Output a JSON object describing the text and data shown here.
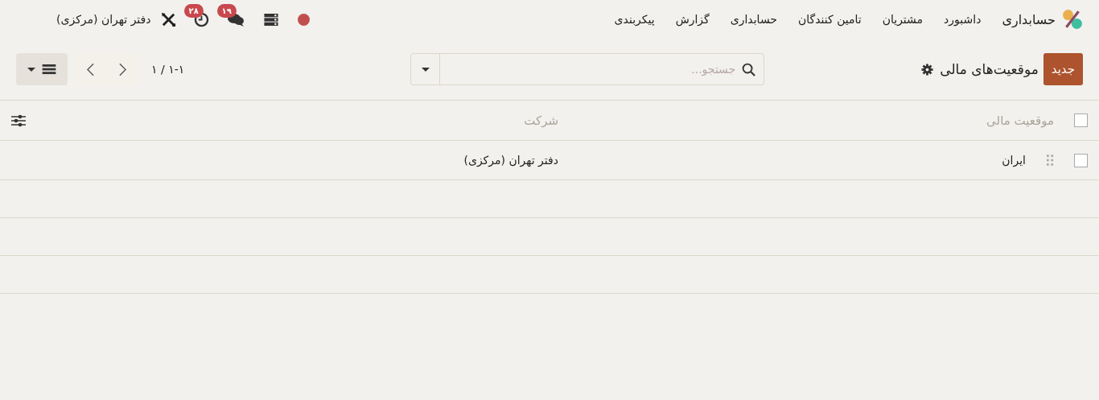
{
  "navbar": {
    "app_name": "حسابداری",
    "menu": [
      "داشبورد",
      "مشتریان",
      "تامین کنندگان",
      "حسابداری",
      "گزارش",
      "پیکربندی"
    ],
    "messages_count": "۱۹",
    "activities_count": "۲۸",
    "company": "دفتر تهران (مرکزی)"
  },
  "control_panel": {
    "new_button": "جدید",
    "title": "موقعیت‌های مالی",
    "search": {
      "placeholder": "جستجو..."
    },
    "pager": "۱-۱ / ۱"
  },
  "table": {
    "columns": [
      "موقعیت مالی",
      "شرکت"
    ],
    "header_checked": false,
    "rows": [
      {
        "checked": false,
        "cells": [
          "ایران",
          "دفتر تهران (مرکزی)"
        ]
      }
    ]
  }
}
